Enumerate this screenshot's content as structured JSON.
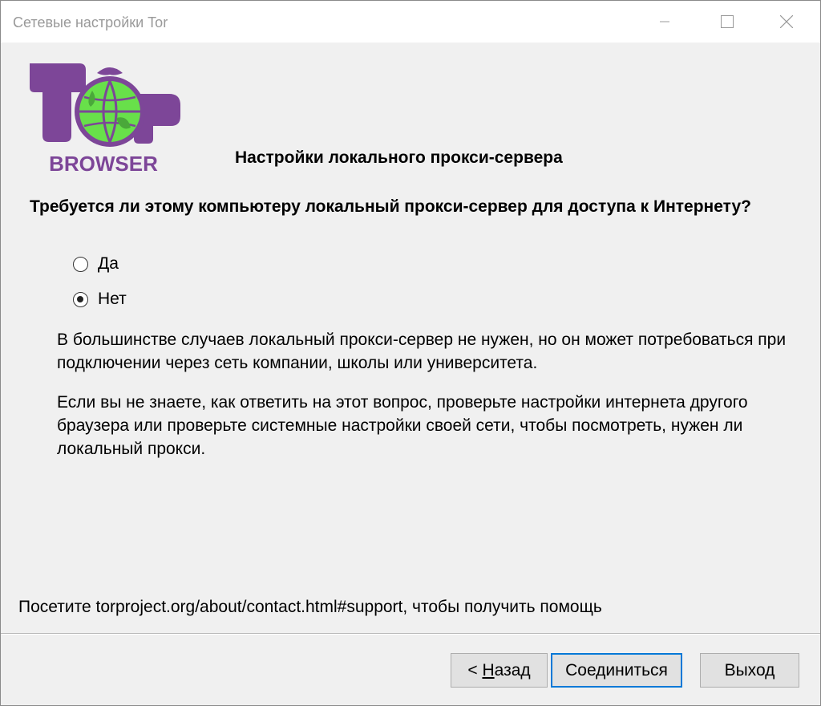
{
  "window": {
    "title": "Сетевые настройки Tor"
  },
  "logo": {
    "text": "BROWSER"
  },
  "header": {
    "section_title": "Настройки локального прокси-сервера"
  },
  "question": {
    "text": "Требуется ли этому компьютеру локальный прокси-сервер для доступа к Интернету?"
  },
  "radios": {
    "yes_label": "Да",
    "no_label": "Нет",
    "selected": "Нет"
  },
  "paragraphs": {
    "p1": "В большинстве случаев локальный прокси-сервер не нужен, но он может потребоваться при подключении через сеть компании, школы или университета.",
    "p2": "Если вы не знаете, как ответить на этот вопрос, проверьте настройки интернета другого браузера или проверьте системные настройки своей сети, чтобы посмотреть, нужен ли локальный прокси."
  },
  "help": {
    "text": "Посетите torproject.org/about/contact.html#support, чтобы получить помощь"
  },
  "buttons": {
    "back_prefix": "< ",
    "back_mnemonic": "Н",
    "back_rest": "азад",
    "connect": "Соединиться",
    "exit": "Выход"
  },
  "colors": {
    "logo_purple": "#7d4698",
    "logo_green": "#68b030",
    "focus_blue": "#0078d7"
  }
}
